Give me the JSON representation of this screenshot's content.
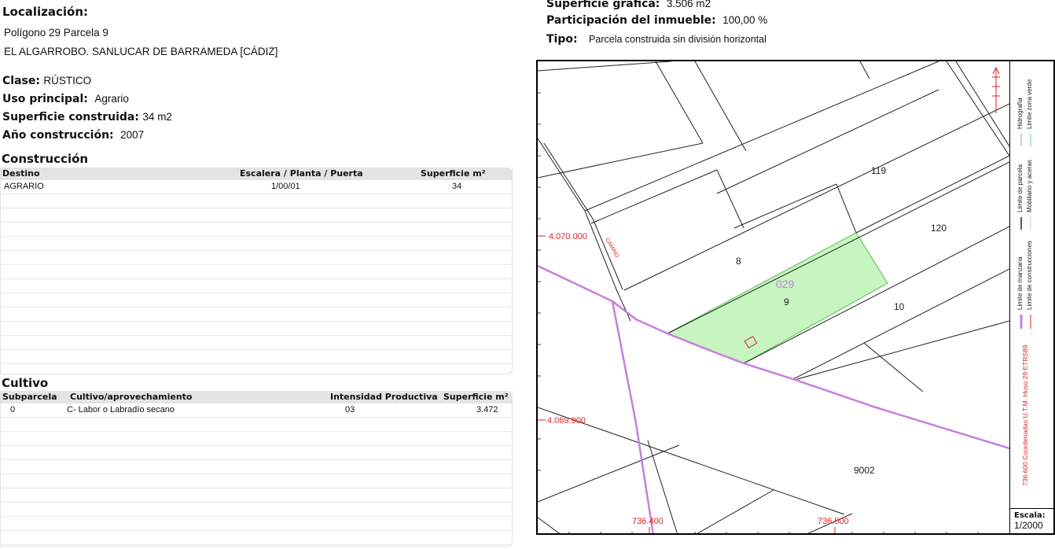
{
  "localizacion": {
    "label": "Localización:",
    "line1": "Polígono 29 Parcela 9",
    "line2": "EL ALGARROBO. SANLUCAR DE BARRAMEDA [CÁDIZ]"
  },
  "clase": {
    "label": "Clase:",
    "value": "RÚSTICO"
  },
  "uso": {
    "label": "Uso principal:",
    "value": "Agrario"
  },
  "superficie_construida": {
    "label": "Superficie construida:",
    "value": "34 m2"
  },
  "anio": {
    "label": "Año construcción:",
    "value": "2007"
  },
  "construccion": {
    "title": "Construcción",
    "headers": [
      "Destino",
      "Escalera / Planta / Puerta",
      "Superficie m²"
    ],
    "rows": [
      [
        "AGRARIO",
        "1/00/01",
        "34"
      ]
    ]
  },
  "cultivo": {
    "title": "Cultivo",
    "headers": [
      "Subparcela",
      "Cultivo/aprovechamiento",
      "Intensidad Productiva",
      "Superficie m²"
    ],
    "rows": [
      [
        "0",
        "C- Labor o Labradío secano",
        "03",
        "3.472"
      ]
    ]
  },
  "superficie_grafica": {
    "label": "Superficie gráfica:",
    "value": "3.506 m2"
  },
  "participacion": {
    "label": "Participación del inmueble:",
    "value": "100,00 %"
  },
  "tipo": {
    "label": "Tipo:",
    "value": "Parcela construida sin división horizontal"
  },
  "map": {
    "parcel_labels": [
      "119",
      "120",
      "8",
      "029",
      "9",
      "10",
      "9002"
    ],
    "road_label": "CAMINO",
    "coord_y": [
      "4.070.000",
      "4.069.900"
    ],
    "coord_x": [
      "736.400",
      "736.500"
    ],
    "utm_note": "736.600 Coordenadas U.T.M. Huso 29 ETRS89",
    "colors": {
      "parcel_fill": "#c6f5c0",
      "parcel_border": "#7fd07a",
      "manzana": "#c77ee0",
      "coords": "#d22"
    },
    "legend": {
      "limite_manzana": "Limite de manzana",
      "limite_construcciones": "Limite de construcciones",
      "limite_parcela": "Limite de parcela",
      "mobiliario": "Mobiliario y aceras",
      "hidrografia": "Hidrografía",
      "zona_verde": "Limite zona verde"
    },
    "scale_label": "Escala:",
    "scale_value": "1/2000"
  }
}
